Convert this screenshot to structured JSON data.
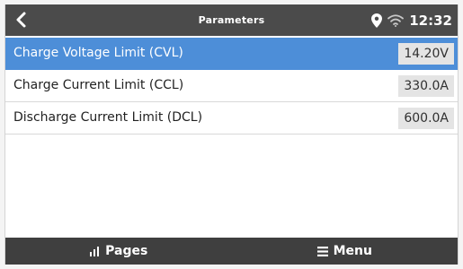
{
  "header": {
    "title": "Parameters",
    "back_icon": "chevron-left-icon",
    "location_icon": "map-pin-icon",
    "wifi_icon": "wifi-icon",
    "clock": "12:32"
  },
  "parameters": [
    {
      "label": "Charge Voltage Limit (CVL)",
      "value": "14.20V",
      "selected": true
    },
    {
      "label": "Charge Current Limit (CCL)",
      "value": "330.0A",
      "selected": false
    },
    {
      "label": "Discharge Current Limit (DCL)",
      "value": "600.0A",
      "selected": false
    }
  ],
  "footer": {
    "pages_label": "Pages",
    "pages_icon": "bar-chart-icon",
    "menu_label": "Menu",
    "menu_icon": "hamburger-menu-icon"
  },
  "colors": {
    "header_bg": "#4b4b4b",
    "selected_row": "#4d8ed8",
    "footer_bg": "#3f3f3f",
    "value_box": "#e4e4e4"
  }
}
